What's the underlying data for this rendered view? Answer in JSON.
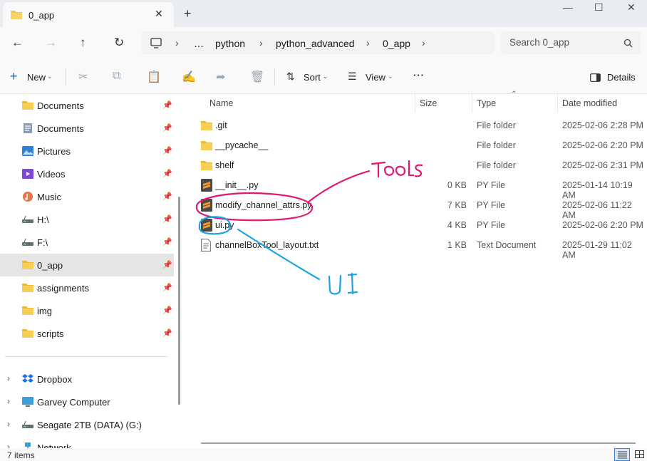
{
  "window": {
    "tab_title": "0_app",
    "new_tab": "+",
    "minimize": "—",
    "maximize": "☐",
    "close": "✕"
  },
  "address": {
    "crumbs": [
      "…",
      "python",
      "python_advanced",
      "0_app"
    ],
    "search_placeholder": "Search 0_app"
  },
  "toolbar": {
    "new_label": "New",
    "sort_label": "Sort",
    "view_label": "View",
    "more_label": "···",
    "details_label": "Details"
  },
  "sidebar": {
    "items": [
      {
        "label": "Documents",
        "icon": "folder-icon",
        "pinned": true
      },
      {
        "label": "Documents",
        "icon": "documents-icon",
        "pinned": true
      },
      {
        "label": "Pictures",
        "icon": "pictures-icon",
        "pinned": true
      },
      {
        "label": "Videos",
        "icon": "videos-icon",
        "pinned": true
      },
      {
        "label": "Music",
        "icon": "music-icon",
        "pinned": true
      },
      {
        "label": "H:\\",
        "icon": "drive-icon",
        "pinned": true
      },
      {
        "label": "F:\\",
        "icon": "drive-icon",
        "pinned": true
      },
      {
        "label": "0_app",
        "icon": "folder-icon",
        "pinned": true,
        "selected": true
      },
      {
        "label": "assignments",
        "icon": "folder-icon",
        "pinned": true
      },
      {
        "label": "img",
        "icon": "folder-icon",
        "pinned": true
      },
      {
        "label": "scripts",
        "icon": "folder-icon",
        "pinned": true
      }
    ],
    "locations": [
      {
        "label": "Dropbox",
        "icon": "dropbox-icon"
      },
      {
        "label": "Garvey Computer",
        "icon": "computer-icon"
      },
      {
        "label": "Seagate 2TB (DATA) (G:)",
        "icon": "drive-icon"
      },
      {
        "label": "Network",
        "icon": "network-icon"
      }
    ]
  },
  "columns": {
    "name": "Name",
    "size": "Size",
    "type": "Type",
    "date": "Date modified"
  },
  "files": [
    {
      "name": ".git",
      "size": "",
      "type": "File folder",
      "date": "2025-02-06 2:28 PM",
      "icon": "folder-icon"
    },
    {
      "name": "__pycache__",
      "size": "",
      "type": "File folder",
      "date": "2025-02-06 2:20 PM",
      "icon": "folder-icon"
    },
    {
      "name": "shelf",
      "size": "",
      "type": "File folder",
      "date": "2025-02-06 2:31 PM",
      "icon": "folder-icon"
    },
    {
      "name": "__init__.py",
      "size": "0 KB",
      "type": "PY File",
      "date": "2025-01-14 10:19 AM",
      "icon": "sublime-file-icon"
    },
    {
      "name": "modify_channel_attrs.py",
      "size": "7 KB",
      "type": "PY File",
      "date": "2025-02-06 11:22 AM",
      "icon": "sublime-file-icon"
    },
    {
      "name": "ui.py",
      "size": "4 KB",
      "type": "PY File",
      "date": "2025-02-06 2:20 PM",
      "icon": "sublime-file-icon"
    },
    {
      "name": "channelBoxTool_layout.txt",
      "size": "1 KB",
      "type": "Text Document",
      "date": "2025-01-29 11:02 AM",
      "icon": "text-file-icon"
    }
  ],
  "status": {
    "item_count": "7 items"
  },
  "annotations": {
    "tools_label": "TOOLS",
    "ui_label": "UI",
    "tools_color": "#e0196e",
    "ui_color": "#1aa3e0"
  }
}
